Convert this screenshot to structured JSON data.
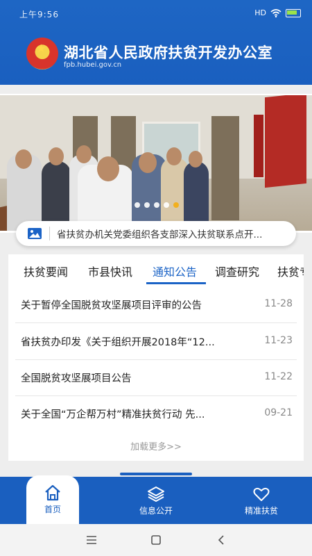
{
  "status_bar": {
    "time": "上午9:56",
    "signal": "HD",
    "colors": {
      "battery": "#9be34a"
    }
  },
  "header": {
    "title": "湖北省人民政府扶贫开发办公室",
    "url": "fpb.hubei.gov.cn",
    "bg_color": "#1a5fbf"
  },
  "banner": {
    "dot_count": 5,
    "active_dot_index": 4
  },
  "notice": {
    "text": "省扶贫办机关党委组织各支部深入扶贫联系点开..."
  },
  "news_tabs": [
    {
      "label": "扶贫要闻"
    },
    {
      "label": "市县快讯"
    },
    {
      "label": "通知公告",
      "active": true
    },
    {
      "label": "调查研究"
    },
    {
      "label": "扶贫专"
    }
  ],
  "news": [
    {
      "title": "关于暂停全国脱贫攻坚展项目评审的公告",
      "date": "11-28"
    },
    {
      "title": "省扶贫办印发《关于组织开展2018年“12...",
      "date": "11-23"
    },
    {
      "title": "全国脱贫攻坚展项目公告",
      "date": "11-22"
    },
    {
      "title": "关于全国“万企帮万村”精准扶贫行动 先...",
      "date": "09-21"
    }
  ],
  "load_more": "加载更多>>",
  "tabbar": {
    "home": "首页",
    "info": "信息公开",
    "poverty": "精准扶贫"
  },
  "colors": {
    "primary": "#1a5fbf",
    "active_dot": "#f2b01e"
  }
}
